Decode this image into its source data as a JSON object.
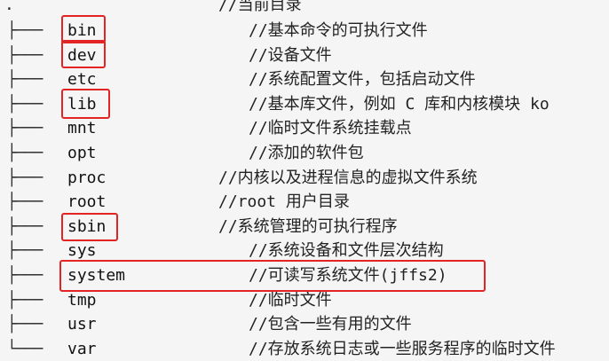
{
  "root": {
    "marker": ".",
    "comment": "//当前目录"
  },
  "entries": [
    {
      "branch": "├───",
      "name": "bin",
      "comment": "//基本命令的可执行文件",
      "highlighted": true
    },
    {
      "branch": "├───",
      "name": "dev",
      "comment": "//设备文件",
      "highlighted": true
    },
    {
      "branch": "├───",
      "name": "etc",
      "comment": "//系统配置文件，包括启动文件",
      "highlighted": false
    },
    {
      "branch": "├───",
      "name": "lib",
      "comment": "//基本库文件，例如 C 库和内核模块 ko",
      "highlighted": true
    },
    {
      "branch": "├───",
      "name": "mnt",
      "comment": "//临时文件系统挂载点",
      "highlighted": false
    },
    {
      "branch": "├───",
      "name": "opt",
      "comment": "//添加的软件包",
      "highlighted": false
    },
    {
      "branch": "├───",
      "name": "proc",
      "comment": "//内核以及进程信息的虚拟文件系统",
      "highlighted": false
    },
    {
      "branch": "├───",
      "name": "root",
      "comment": "//root 用户目录",
      "highlighted": false
    },
    {
      "branch": "├───",
      "name": "sbin",
      "comment": "//系统管理的可执行程序",
      "highlighted": true
    },
    {
      "branch": "├───",
      "name": "sys",
      "comment": "//系统设备和文件层次结构",
      "highlighted": false
    },
    {
      "branch": "├───",
      "name": "system",
      "comment": "//可读写系统文件(jffs2)",
      "highlighted": true
    },
    {
      "branch": "├───",
      "name": "tmp",
      "comment": "//临时文件",
      "highlighted": false
    },
    {
      "branch": "├───",
      "name": "usr",
      "comment": "//包含一些有用的文件",
      "highlighted": false
    },
    {
      "branch": "└───",
      "name": "var",
      "comment": "//存放系统日志或一些服务程序的临时文件",
      "highlighted": false
    }
  ],
  "colors": {
    "background": "#f5f5f5",
    "highlight": "#e32424",
    "text": "#222222"
  }
}
